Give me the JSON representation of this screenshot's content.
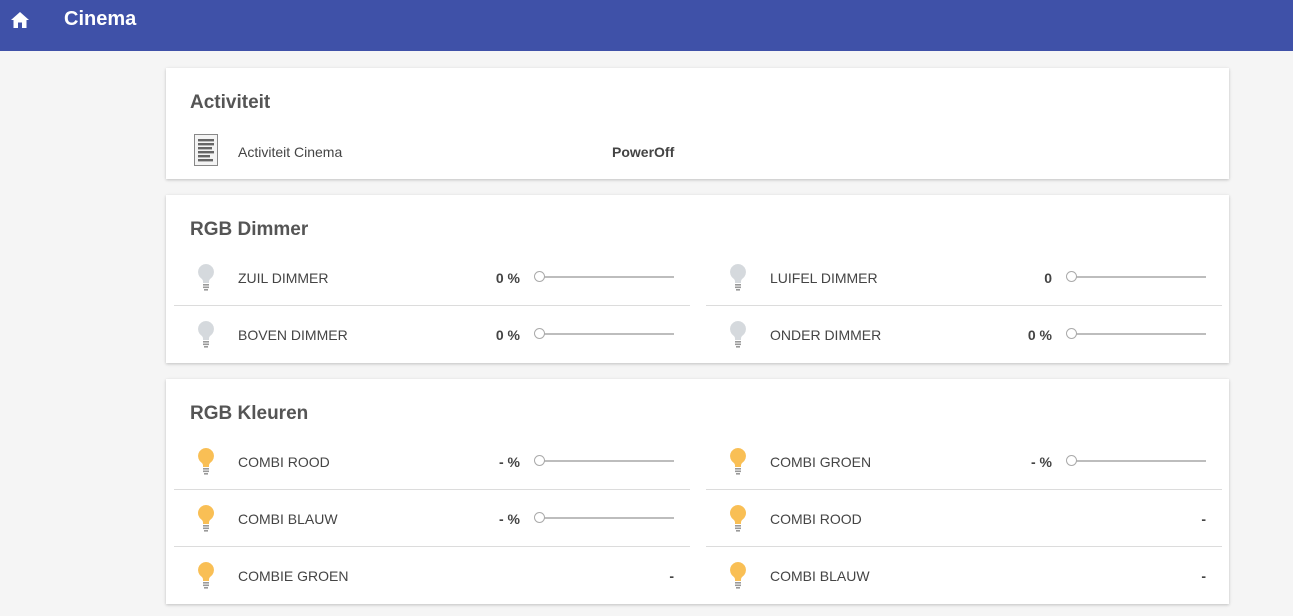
{
  "header": {
    "title": "Cinema",
    "home_icon": "home-icon"
  },
  "colors": {
    "header_bg": "#3f51a8",
    "bulb_off": "#d5d9dd",
    "bulb_on": "#f9bf55"
  },
  "activity": {
    "title": "Activiteit",
    "item": {
      "label": "Activiteit Cinema",
      "value": "PowerOff",
      "icon": "document-icon"
    }
  },
  "rgb_dimmer": {
    "title": "RGB Dimmer",
    "items": [
      {
        "label": "ZUIL DIMMER",
        "value": "0 %",
        "level": 0
      },
      {
        "label": "LUIFEL DIMMER",
        "value": "0",
        "level": 0
      },
      {
        "label": "BOVEN DIMMER",
        "value": "0 %",
        "level": 0
      },
      {
        "label": "ONDER DIMMER",
        "value": "0 %",
        "level": 0
      }
    ]
  },
  "rgb_kleuren": {
    "title": "RGB Kleuren",
    "items": [
      {
        "label": "COMBI ROOD",
        "value": "- %",
        "level": 0
      },
      {
        "label": "COMBI GROEN",
        "value": "- %",
        "level": 0
      },
      {
        "label": "COMBI BLAUW",
        "value": "- %",
        "level": 0
      },
      {
        "label": "COMBI ROOD",
        "value": "-"
      },
      {
        "label": "COMBIE GROEN",
        "value": "-"
      },
      {
        "label": "COMBI BLAUW",
        "value": "-"
      }
    ]
  }
}
